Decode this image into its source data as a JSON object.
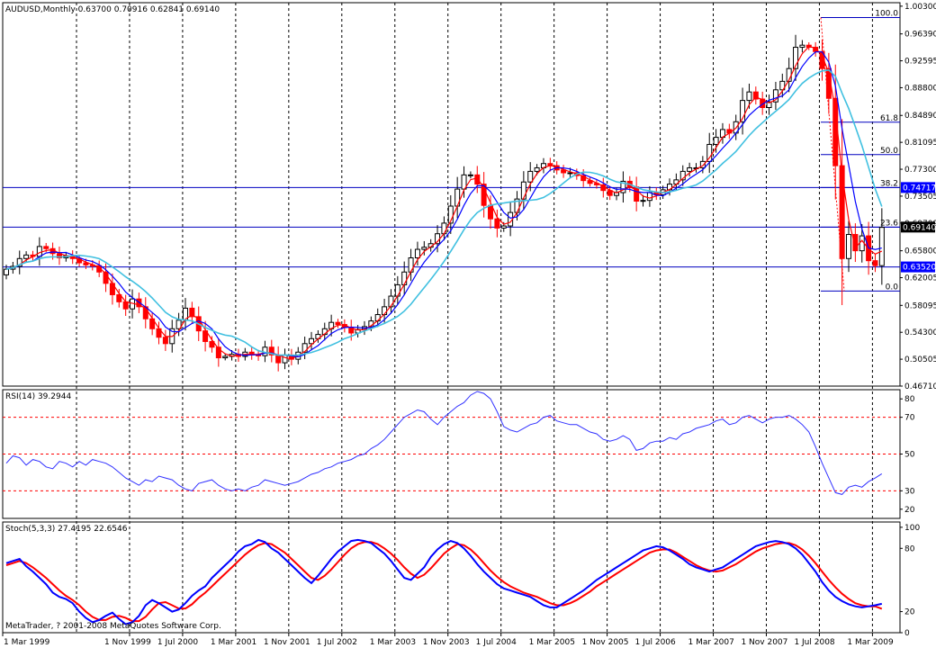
{
  "chart_data": {
    "type": "candlestick",
    "main": {
      "title": "AUDUSD,Monthly  0.63700 0.70916 0.62841 0.69140",
      "ylim": [
        0.4671,
        1.0079
      ],
      "y_ticks": [
        "1.00300",
        "0.96390",
        "0.92595",
        "0.88800",
        "0.84890",
        "0.81095",
        "0.77300",
        "0.73505",
        "0.69709",
        "0.65800",
        "0.62005",
        "0.58095",
        "0.54300",
        "0.50505",
        "0.46710"
      ],
      "h_lines": [
        0.7472,
        0.6914,
        0.6352
      ],
      "price_markers": [
        {
          "value": 0.7472,
          "label": "0.74717",
          "color": "#0000ff"
        },
        {
          "value": 0.6914,
          "label": "0.69140",
          "color": "#000000"
        },
        {
          "value": 0.6352,
          "label": "0.63520",
          "color": "#0000ff"
        }
      ],
      "fib_levels": [
        {
          "label": "100.0",
          "value": 0.9869
        },
        {
          "label": "61.8",
          "value": 0.8393
        },
        {
          "label": "50.0",
          "value": 0.7936
        },
        {
          "label": "38.2",
          "value": 0.7472
        },
        {
          "label": "23.6",
          "value": 0.6914
        },
        {
          "label": "0.0",
          "value": 0.6012
        }
      ],
      "closes": [
        0.632,
        0.636,
        0.647,
        0.652,
        0.65,
        0.664,
        0.661,
        0.654,
        0.648,
        0.651,
        0.647,
        0.641,
        0.638,
        0.637,
        0.628,
        0.612,
        0.596,
        0.586,
        0.576,
        0.59,
        0.579,
        0.562,
        0.548,
        0.536,
        0.527,
        0.548,
        0.56,
        0.577,
        0.565,
        0.545,
        0.53,
        0.522,
        0.507,
        0.509,
        0.512,
        0.509,
        0.515,
        0.511,
        0.51,
        0.522,
        0.511,
        0.5,
        0.511,
        0.505,
        0.515,
        0.527,
        0.534,
        0.54,
        0.548,
        0.557,
        0.554,
        0.55,
        0.542,
        0.547,
        0.551,
        0.559,
        0.568,
        0.579,
        0.594,
        0.61,
        0.628,
        0.648,
        0.66,
        0.663,
        0.668,
        0.682,
        0.697,
        0.721,
        0.745,
        0.765,
        0.765,
        0.752,
        0.722,
        0.703,
        0.69,
        0.693,
        0.712,
        0.731,
        0.755,
        0.77,
        0.775,
        0.781,
        0.778,
        0.772,
        0.768,
        0.768,
        0.764,
        0.757,
        0.753,
        0.751,
        0.743,
        0.736,
        0.74,
        0.756,
        0.748,
        0.728,
        0.729,
        0.74,
        0.737,
        0.744,
        0.752,
        0.758,
        0.77,
        0.775,
        0.775,
        0.784,
        0.808,
        0.818,
        0.829,
        0.824,
        0.84,
        0.87,
        0.882,
        0.872,
        0.86,
        0.868,
        0.885,
        0.897,
        0.915,
        0.945,
        0.948,
        0.945,
        0.939,
        0.915,
        0.873,
        0.778,
        0.647,
        0.681,
        0.658,
        0.679,
        0.644,
        0.637,
        0.691
      ],
      "series": [
        {
          "name": "MA fast",
          "color": "#ff0000"
        },
        {
          "name": "MA mid",
          "color": "#0000ff"
        },
        {
          "name": "MA slow",
          "color": "#40c0e0"
        }
      ]
    },
    "rsi": {
      "title": "RSI(14) 39.2944",
      "ylim": [
        15,
        85
      ],
      "y_ticks": [
        "80",
        "70",
        "50",
        "30",
        "20"
      ],
      "levels": [
        70,
        50,
        30
      ],
      "values": [
        45,
        49,
        48,
        44,
        47,
        46,
        43,
        42,
        46,
        45,
        43,
        46,
        44,
        47,
        46,
        45,
        43,
        40,
        37,
        35,
        33,
        36,
        35,
        38,
        37,
        36,
        33,
        31,
        30,
        34,
        35,
        36,
        33,
        31,
        30,
        31,
        30,
        32,
        33,
        36,
        35,
        34,
        33,
        34,
        35,
        37,
        39,
        40,
        42,
        43,
        45,
        46,
        47,
        49,
        50,
        53,
        55,
        58,
        62,
        66,
        70,
        72,
        74,
        73,
        69,
        66,
        70,
        73,
        76,
        78,
        82,
        84,
        83,
        80,
        73,
        65,
        63,
        62,
        64,
        66,
        67,
        70,
        71,
        68,
        67,
        66,
        66,
        64,
        62,
        61,
        58,
        57,
        58,
        60,
        58,
        52,
        53,
        56,
        57,
        57,
        59,
        58,
        61,
        62,
        64,
        65,
        66,
        68,
        69,
        66,
        67,
        70,
        71,
        69,
        67,
        69,
        70,
        70,
        71,
        69,
        66,
        62,
        54,
        45,
        37,
        29,
        28,
        32,
        33,
        32,
        35,
        37,
        39.3
      ]
    },
    "stoch": {
      "title": "Stoch(5,3,3) 27.4195 22.6546",
      "ylim": [
        0,
        105
      ],
      "y_ticks": [
        "100",
        "80",
        "20",
        "0"
      ],
      "main": [
        66,
        68,
        70,
        63,
        58,
        52,
        46,
        38,
        34,
        32,
        28,
        20,
        14,
        10,
        12,
        16,
        19,
        13,
        8,
        10,
        16,
        26,
        31,
        28,
        24,
        20,
        22,
        28,
        35,
        40,
        44,
        52,
        58,
        64,
        70,
        77,
        82,
        84,
        88,
        86,
        80,
        76,
        70,
        64,
        58,
        52,
        47,
        54,
        62,
        70,
        77,
        82,
        87,
        88,
        87,
        85,
        80,
        75,
        68,
        60,
        52,
        50,
        56,
        62,
        72,
        79,
        84,
        87,
        85,
        80,
        73,
        65,
        58,
        52,
        46,
        42,
        40,
        38,
        36,
        34,
        30,
        26,
        24,
        24,
        28,
        32,
        36,
        40,
        45,
        50,
        54,
        58,
        62,
        66,
        70,
        74,
        78,
        80,
        82,
        81,
        78,
        74,
        70,
        65,
        62,
        60,
        58,
        60,
        62,
        66,
        70,
        74,
        78,
        82,
        84,
        86,
        87,
        86,
        84,
        80,
        74,
        66,
        58,
        48,
        40,
        34,
        30,
        27,
        25,
        24,
        25,
        26,
        27.4
      ],
      "signal": [
        64,
        66,
        68,
        66,
        62,
        57,
        52,
        46,
        40,
        35,
        31,
        26,
        20,
        15,
        12,
        12,
        15,
        16,
        14,
        11,
        11,
        15,
        22,
        28,
        29,
        26,
        23,
        23,
        27,
        33,
        38,
        44,
        50,
        56,
        62,
        68,
        74,
        79,
        83,
        85,
        84,
        80,
        76,
        70,
        64,
        58,
        52,
        50,
        54,
        60,
        67,
        74,
        80,
        84,
        86,
        86,
        84,
        80,
        75,
        69,
        62,
        56,
        52,
        55,
        61,
        68,
        75,
        80,
        84,
        83,
        79,
        73,
        66,
        59,
        53,
        48,
        44,
        41,
        38,
        36,
        34,
        31,
        28,
        26,
        26,
        28,
        31,
        35,
        39,
        44,
        48,
        52,
        56,
        60,
        64,
        68,
        72,
        76,
        78,
        79,
        79,
        76,
        72,
        68,
        64,
        61,
        59,
        58,
        59,
        62,
        65,
        69,
        73,
        77,
        80,
        82,
        84,
        85,
        85,
        83,
        79,
        73,
        66,
        58,
        50,
        43,
        37,
        32,
        28,
        26,
        25,
        25,
        22.7
      ]
    },
    "x_labels": [
      "1 Mar 1999",
      "1 Nov 1999",
      "1 Jul 2000",
      "1 Mar 2001",
      "1 Nov 2001",
      "1 Jul 2002",
      "1 Mar 2003",
      "1 Nov 2003",
      "1 Jul 2004",
      "1 Mar 2005",
      "1 Nov 2005",
      "1 Jul 2006",
      "1 Mar 2007",
      "1 Nov 2007",
      "1 Jul 2008",
      "1 Mar 2009"
    ],
    "footer": "MetaTrader, ? 2001-2008 MetaQuotes Software Corp."
  }
}
